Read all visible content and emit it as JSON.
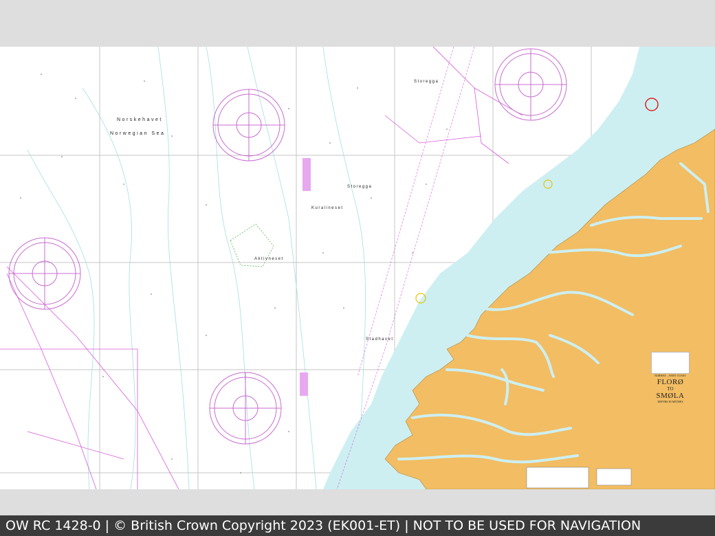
{
  "colors": {
    "land": "#f2bd63",
    "shallow_water": "#cdeff2",
    "magenta": "#d85ad8",
    "grid": "#bdbdbd",
    "contour": "#9fd8df",
    "footer_bg": "#3b3b3b"
  },
  "map": {
    "sea_labels": [
      "Norskehavet",
      "Norwegian Sea"
    ],
    "place_labels": [
      "Storegga",
      "Storegga",
      "Kuralineset",
      "Aktivneset",
      "Stadhavet"
    ],
    "title_block": {
      "region": "NORWAY – WEST COAST",
      "from": "FLORØ",
      "to_word": "TO",
      "to": "SMØLA",
      "depths": "DEPTHS IN METRES"
    }
  },
  "footer": {
    "text": "OW RC 1428-0 | © British Crown Copyright 2023 (EK001-ET) | NOT TO BE USED FOR NAVIGATION"
  }
}
